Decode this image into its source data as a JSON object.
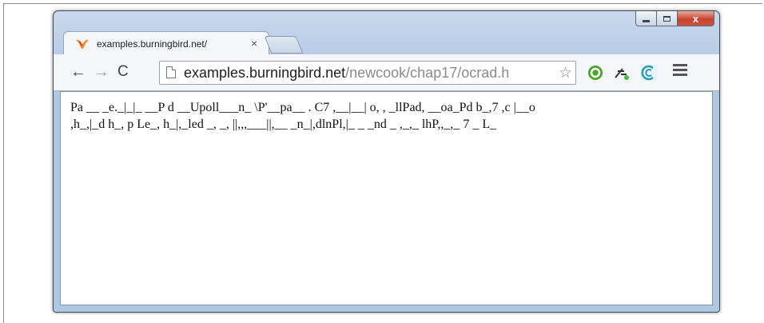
{
  "window": {
    "controls": {
      "minimize": "minimize",
      "maximize": "maximize",
      "close": "x"
    }
  },
  "tab": {
    "title": "examples.burningbird.net/",
    "close_label": "×",
    "favicon": "burningbird-bird-icon"
  },
  "toolbar": {
    "back_icon": "←",
    "forward_icon": "→",
    "reload_icon": "C",
    "url_host": "examples.burningbird.net",
    "url_path": "/newcook/chap17/ocrad.h",
    "star_icon": "☆",
    "extensions": [
      "green-extension-icon",
      "dial-extension-icon",
      "teal-extension-icon"
    ]
  },
  "page": {
    "lines": [
      "Pa __ _e._|_|_ __P d __Upoll___n_ \\P'__pa__ . C7 ,__|__| o, , _llPad, __oa_Pd b_,7 ,c |__o",
      ",h_,|_d h_, p Le_, h_|,_led _, _, ||,,,___||,__ _n_|,dlnPl,|_ _ _nd _ ,_,_ lhP,,_,_ 7 _ L_"
    ]
  },
  "colors": {
    "close_button": "#c8452f",
    "window_frame": "#bcd0e8"
  }
}
